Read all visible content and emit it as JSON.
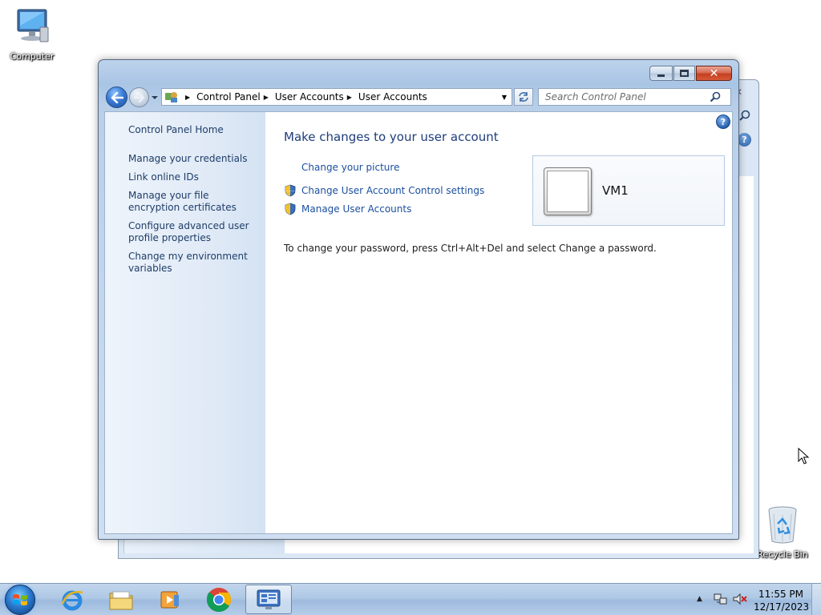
{
  "desktop": {
    "icons": [
      {
        "label": "Computer"
      },
      {
        "label": "Recycle Bin"
      }
    ]
  },
  "window": {
    "breadcrumb": [
      "Control Panel",
      "User Accounts",
      "User Accounts"
    ],
    "search_placeholder": "Search Control Panel",
    "sidebar": {
      "home": "Control Panel Home",
      "links": [
        "Manage your credentials",
        "Link online IDs",
        "Manage your file encryption certificates",
        "Configure advanced user profile properties",
        "Change my environment variables"
      ]
    },
    "main": {
      "title": "Make changes to your user account",
      "tasks": [
        {
          "label": "Change your picture",
          "icon": "none"
        },
        {
          "label": "Change User Account Control settings",
          "icon": "uac-shield-icon"
        },
        {
          "label": "Manage User Accounts",
          "icon": "uac-shield-icon"
        }
      ],
      "password_note": "To change your password, press Ctrl+Alt+Del and select Change a password.",
      "account": {
        "name": "VM1"
      }
    }
  },
  "taskbar": {
    "apps": [
      "internet-explorer",
      "windows-explorer",
      "media-player",
      "chrome",
      "control-panel"
    ],
    "active_app": "control-panel",
    "clock": {
      "time": "11:55 PM",
      "date": "12/17/2023"
    }
  },
  "colors": {
    "link": "#1b4fa0",
    "title": "#1e3d7a",
    "taskbar": "#aec8e5"
  }
}
